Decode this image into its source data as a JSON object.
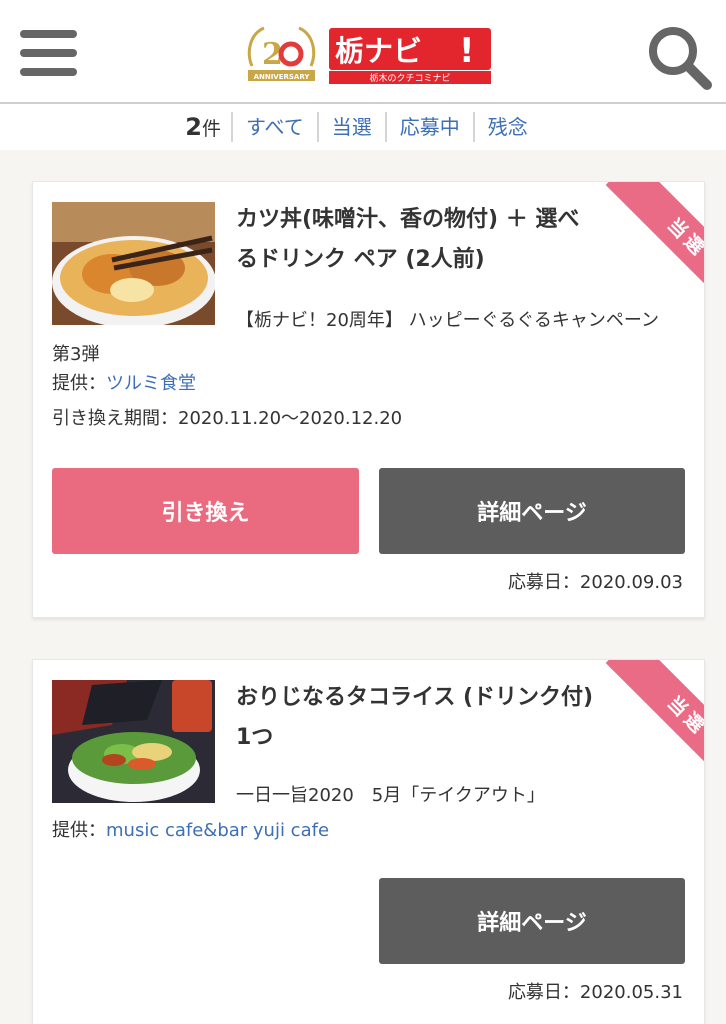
{
  "header": {
    "menu_icon": "hamburger-menu-icon",
    "search_icon": "search-icon",
    "anniversary_logo_text": "20 ANNIVERSARY",
    "site_logo_text": "栃ナビ！",
    "site_logo_sub": "栃木のクチコミナビ"
  },
  "filter": {
    "count_number": "2",
    "count_unit": "件",
    "tabs": [
      "すべて",
      "当選",
      "応募中",
      "残念"
    ]
  },
  "colors": {
    "accent_pink": "#ea6b80",
    "detail_gray": "#5d5d5d",
    "link_blue": "#3d6fb6"
  },
  "items": [
    {
      "badge": "当選",
      "title": "カツ丼(味噌汁、香の物付) ＋ 選べるドリンク ペア (2人前)",
      "campaign": "【栃ナビ！20周年】 ハッピーぐるぐるキャンペーン 第3弾",
      "provider_label": "提供：",
      "provider_name": "ツルミ食堂",
      "period": "引き換え期間：2020.11.20〜2020.12.20",
      "redeem_label": "引き換え",
      "detail_label": "詳細ページ",
      "applied_date": "応募日：2020.09.03"
    },
    {
      "badge": "当選",
      "title": "おりじなるタコライス (ドリンク付) 1つ",
      "campaign": "一日一旨2020　5月「テイクアウト」",
      "provider_label": "提供：",
      "provider_name": "music cafe&bar yuji cafe",
      "detail_label": "詳細ページ",
      "applied_date": "応募日：2020.05.31"
    }
  ]
}
